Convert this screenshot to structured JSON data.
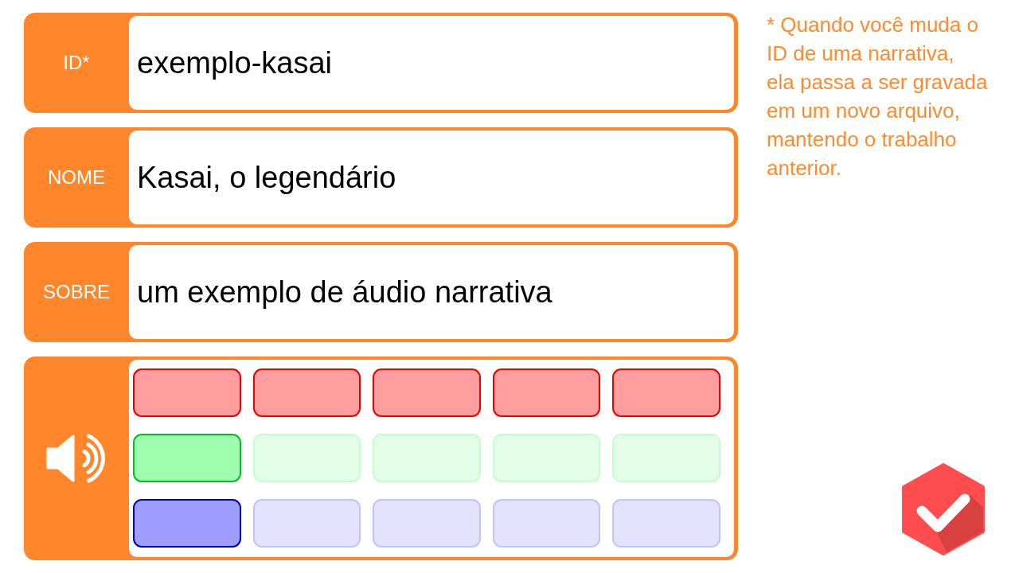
{
  "fields": [
    {
      "label": "ID*",
      "value": "exemplo-kasai"
    },
    {
      "label": "NOME",
      "value": "Kasai, o legendário"
    },
    {
      "label": "SOBRE",
      "value": "um exemplo de áudio narrativa"
    }
  ],
  "audio": {
    "meters": [
      {
        "color": "#ee0000",
        "cells": [
          {
            "on": true
          },
          {
            "on": true
          },
          {
            "on": true
          },
          {
            "on": true
          },
          {
            "on": true
          }
        ]
      },
      {
        "color": "#00c020",
        "cells": [
          {
            "on": true
          },
          {
            "on": false
          },
          {
            "on": false
          },
          {
            "on": false
          },
          {
            "on": false
          }
        ]
      },
      {
        "color": "#0000c0",
        "cells": [
          {
            "on": true
          },
          {
            "on": false
          },
          {
            "on": false
          },
          {
            "on": false
          },
          {
            "on": false
          }
        ]
      }
    ]
  },
  "note": "* Quando você muda o\nID de uma narrativa,\nela passa a ser gravada\nem um novo arquivo,\nmantendo o trabalho\nanterior."
}
